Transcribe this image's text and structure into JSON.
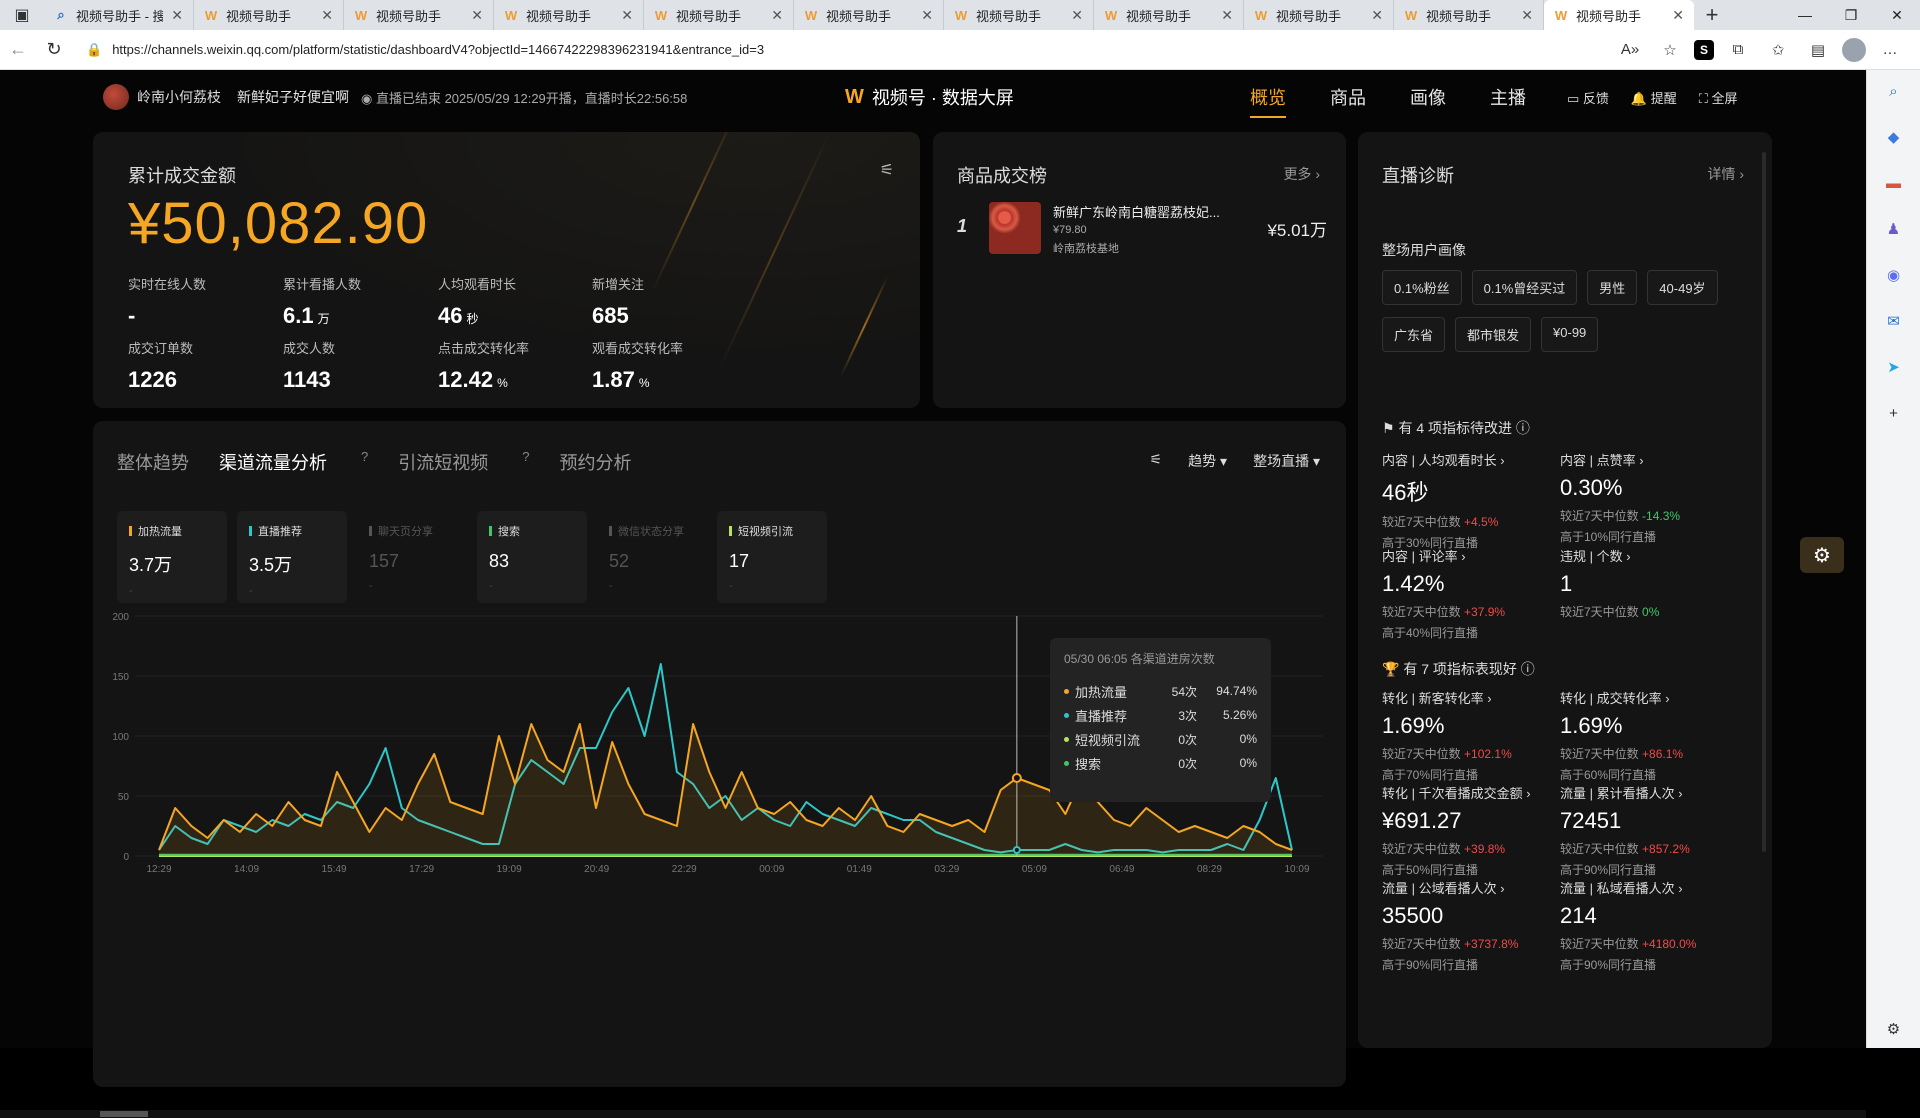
{
  "browser": {
    "tabs": [
      {
        "label": "视频号助手 - 搜",
        "icon": "search-icon"
      },
      {
        "label": "视频号助手",
        "icon": "channels-logo-icon"
      },
      {
        "label": "视频号助手",
        "icon": "channels-logo-icon"
      },
      {
        "label": "视频号助手",
        "icon": "channels-logo-icon"
      },
      {
        "label": "视频号助手",
        "icon": "channels-logo-icon"
      },
      {
        "label": "视频号助手",
        "icon": "channels-logo-icon"
      },
      {
        "label": "视频号助手",
        "icon": "channels-logo-icon"
      },
      {
        "label": "视频号助手",
        "icon": "channels-logo-icon"
      },
      {
        "label": "视频号助手",
        "icon": "channels-logo-icon"
      },
      {
        "label": "视频号助手",
        "icon": "channels-logo-icon"
      },
      {
        "label": "视频号助手",
        "icon": "channels-logo-icon",
        "active": true
      }
    ],
    "url": "https://channels.weixin.qq.com/platform/statistic/dashboardV4?objectId=14667422298396231941&entrance_id=3"
  },
  "header": {
    "streamer_name": "岭南小何荔枝",
    "live_title": "新鲜妃子好便宜啊",
    "live_status": "◉ 直播已结束 2025/05/29 12:29开播，直播时长22:56:58",
    "brand_logo": "W",
    "brand_title": "视频号 · 数据大屏",
    "nav_tabs": [
      "概览",
      "商品",
      "画像",
      "主播"
    ],
    "active_tab": "概览",
    "tools": [
      "反馈",
      "提醒",
      "全屏"
    ]
  },
  "summary": {
    "title": "累计成交金额",
    "total": "¥50,082.90",
    "metrics": [
      {
        "label": "实时在线人数",
        "value": "-",
        "unit": ""
      },
      {
        "label": "累计看播人数",
        "value": "6.1",
        "unit": "万"
      },
      {
        "label": "人均观看时长",
        "value": "46",
        "unit": "秒"
      },
      {
        "label": "新增关注",
        "value": "685",
        "unit": ""
      },
      {
        "label": "成交订单数",
        "value": "1226",
        "unit": ""
      },
      {
        "label": "成交人数",
        "value": "1143",
        "unit": ""
      },
      {
        "label": "点击成交转化率",
        "value": "12.42",
        "unit": "%"
      },
      {
        "label": "观看成交转化率",
        "value": "1.87",
        "unit": "%"
      }
    ]
  },
  "ranking": {
    "title": "商品成交榜",
    "more": "更多 ›",
    "items": [
      {
        "rank": "1",
        "name": "新鲜广东岭南白糖罂荔枝妃...",
        "price": "¥79.80",
        "shop": "岭南荔枝基地",
        "sales": "¥5.01万"
      }
    ]
  },
  "diagnosis": {
    "title": "直播诊断",
    "more": "详情 ›",
    "audience_title": "整场用户画像",
    "tags": [
      "0.1%粉丝",
      "0.1%曾经买过",
      "男性",
      "40-49岁",
      "广东省",
      "都市银发",
      "¥0-99"
    ],
    "improve_title": "有 4 项指标待改进 ⓘ",
    "improve": [
      {
        "label": "内容 | 人均观看时长 ›",
        "value": "46秒",
        "cmp": "较近7天中位数",
        "delta": "+4.5%",
        "dir": "up",
        "peer": "高于30%同行直播"
      },
      {
        "label": "内容 | 点赞率 ›",
        "value": "0.30%",
        "cmp": "较近7天中位数",
        "delta": "-14.3%",
        "dir": "dn",
        "peer": "高于10%同行直播"
      },
      {
        "label": "内容 | 评论率 ›",
        "value": "1.42%",
        "cmp": "较近7天中位数",
        "delta": "+37.9%",
        "dir": "up",
        "peer": "高于40%同行直播"
      },
      {
        "label": "违规 | 个数 ›",
        "value": "1",
        "cmp": "较近7天中位数",
        "delta": "0%",
        "dir": "dn",
        "peer": ""
      }
    ],
    "good_title": "有 7 项指标表现好 ⓘ",
    "good": [
      {
        "label": "转化 | 新客转化率 ›",
        "value": "1.69%",
        "cmp": "较近7天中位数",
        "delta": "+102.1%",
        "dir": "up",
        "peer": "高于70%同行直播"
      },
      {
        "label": "转化 | 成交转化率 ›",
        "value": "1.69%",
        "cmp": "较近7天中位数",
        "delta": "+86.1%",
        "dir": "up",
        "peer": "高于60%同行直播"
      },
      {
        "label": "转化 | 千次看播成交金额 ›",
        "value": "¥691.27",
        "cmp": "较近7天中位数",
        "delta": "+39.8%",
        "dir": "up",
        "peer": "高于50%同行直播"
      },
      {
        "label": "流量 | 累计看播人次 ›",
        "value": "72451",
        "cmp": "较近7天中位数",
        "delta": "+857.2%",
        "dir": "up",
        "peer": "高于90%同行直播"
      },
      {
        "label": "流量 | 公域看播人次 ›",
        "value": "35500",
        "cmp": "较近7天中位数",
        "delta": "+3737.8%",
        "dir": "up",
        "peer": "高于90%同行直播"
      },
      {
        "label": "流量 | 私域看播人次 ›",
        "value": "214",
        "cmp": "较近7天中位数",
        "delta": "+4180.0%",
        "dir": "up",
        "peer": "高于90%同行直播"
      }
    ]
  },
  "traffic": {
    "tabs": [
      "整体趋势",
      "渠道流量分析",
      "引流短视频",
      "预约分析"
    ],
    "active_tab": "渠道流量分析",
    "tools": [
      "趋势 ▾",
      "整场直播 ▾"
    ],
    "channels": [
      {
        "label": "加热流量",
        "value": "3.7万",
        "color": "#f5a623",
        "dim": false
      },
      {
        "label": "直播推荐",
        "value": "3.5万",
        "color": "#2ec7c9",
        "dim": false
      },
      {
        "label": "聊天页分享",
        "value": "157",
        "color": "#555555",
        "dim": true
      },
      {
        "label": "搜索",
        "value": "83",
        "color": "#3ec86a",
        "dim": false
      },
      {
        "label": "微信状态分享",
        "value": "52",
        "color": "#555555",
        "dim": true
      },
      {
        "label": "短视频引流",
        "value": "17",
        "color": "#b6e35a",
        "dim": false
      }
    ],
    "tooltip": {
      "title": "05/30 06:05 各渠道进房次数",
      "rows": [
        {
          "name": "加热流量",
          "count": "54次",
          "pct": "94.74%",
          "color": "#f5a623"
        },
        {
          "name": "直播推荐",
          "count": "3次",
          "pct": "5.26%",
          "color": "#2ec7c9"
        },
        {
          "name": "短视频引流",
          "count": "0次",
          "pct": "0%",
          "color": "#b6e35a"
        },
        {
          "name": "搜索",
          "count": "0次",
          "pct": "0%",
          "color": "#3ec86a"
        }
      ]
    }
  },
  "chart_data": {
    "type": "line",
    "x": [
      "12:29",
      "14:09",
      "15:49",
      "17:29",
      "19:09",
      "20:49",
      "22:29",
      "00:09",
      "01:49",
      "03:29",
      "05:09",
      "06:49",
      "08:29",
      "10:09"
    ],
    "ylim": [
      0,
      200
    ],
    "yticks": [
      0,
      50,
      100,
      150,
      200
    ],
    "series": [
      {
        "name": "加热流量",
        "color": "#f5a623",
        "values": [
          5,
          40,
          25,
          15,
          30,
          20,
          35,
          25,
          45,
          30,
          25,
          70,
          45,
          20,
          40,
          30,
          60,
          85,
          45,
          40,
          35,
          100,
          60,
          110,
          80,
          70,
          110,
          40,
          95,
          60,
          35,
          30,
          25,
          110,
          70,
          40,
          70,
          40,
          35,
          45,
          30,
          25,
          40,
          30,
          50,
          25,
          20,
          35,
          30,
          25,
          30,
          20,
          55,
          65,
          60,
          55,
          35,
          65,
          45,
          30,
          25,
          40,
          30,
          20,
          25,
          20,
          15,
          25,
          20,
          10,
          5
        ]
      },
      {
        "name": "直播推荐",
        "color": "#2ec7c9",
        "values": [
          5,
          25,
          15,
          10,
          30,
          25,
          20,
          30,
          25,
          35,
          30,
          45,
          40,
          60,
          90,
          40,
          30,
          25,
          20,
          15,
          10,
          10,
          60,
          80,
          70,
          60,
          90,
          90,
          120,
          140,
          100,
          160,
          70,
          60,
          40,
          50,
          30,
          40,
          30,
          25,
          45,
          35,
          30,
          25,
          40,
          35,
          30,
          30,
          20,
          15,
          10,
          5,
          3,
          5,
          5,
          5,
          10,
          5,
          3,
          5,
          5,
          5,
          3,
          5,
          5,
          5,
          10,
          5,
          30,
          65,
          5
        ]
      },
      {
        "name": "搜索",
        "color": "#3ec86a",
        "values": [
          1,
          1,
          1,
          1,
          1,
          1,
          1,
          1,
          1,
          1,
          1,
          1,
          1,
          1,
          1,
          1,
          1,
          1,
          1,
          1,
          1,
          1,
          1,
          1,
          1,
          1,
          1,
          1,
          1,
          1,
          1,
          1,
          1,
          1,
          1,
          1,
          1,
          1,
          1,
          1,
          1,
          1,
          1,
          1,
          1,
          1,
          1,
          1,
          1,
          1,
          1,
          1,
          1,
          1,
          1,
          1,
          1,
          1,
          1,
          1,
          1,
          1,
          1,
          1,
          1,
          1,
          1,
          1,
          1,
          1,
          1
        ]
      },
      {
        "name": "短视频引流",
        "color": "#b6e35a",
        "values": [
          0,
          0,
          0,
          0,
          0,
          0,
          0,
          0,
          0,
          0,
          0,
          0,
          0,
          0,
          0,
          0,
          0,
          0,
          0,
          0,
          0,
          0,
          0,
          0,
          0,
          0,
          0,
          0,
          0,
          0,
          0,
          0,
          0,
          0,
          0,
          0,
          0,
          0,
          0,
          0,
          0,
          0,
          0,
          0,
          0,
          0,
          0,
          0,
          0,
          0,
          0,
          0,
          0,
          0,
          0,
          0,
          0,
          0,
          0,
          0,
          0,
          0,
          0,
          0,
          0,
          0,
          0,
          0,
          0,
          0,
          0
        ]
      }
    ],
    "cursor_x_index": 53
  },
  "sidebar_edge": {
    "icons": [
      "search-icon",
      "tag-icon",
      "briefcase-icon",
      "chess-icon",
      "copilot-icon",
      "outlook-icon",
      "send-icon",
      "add-icon",
      "settings-icon"
    ]
  }
}
